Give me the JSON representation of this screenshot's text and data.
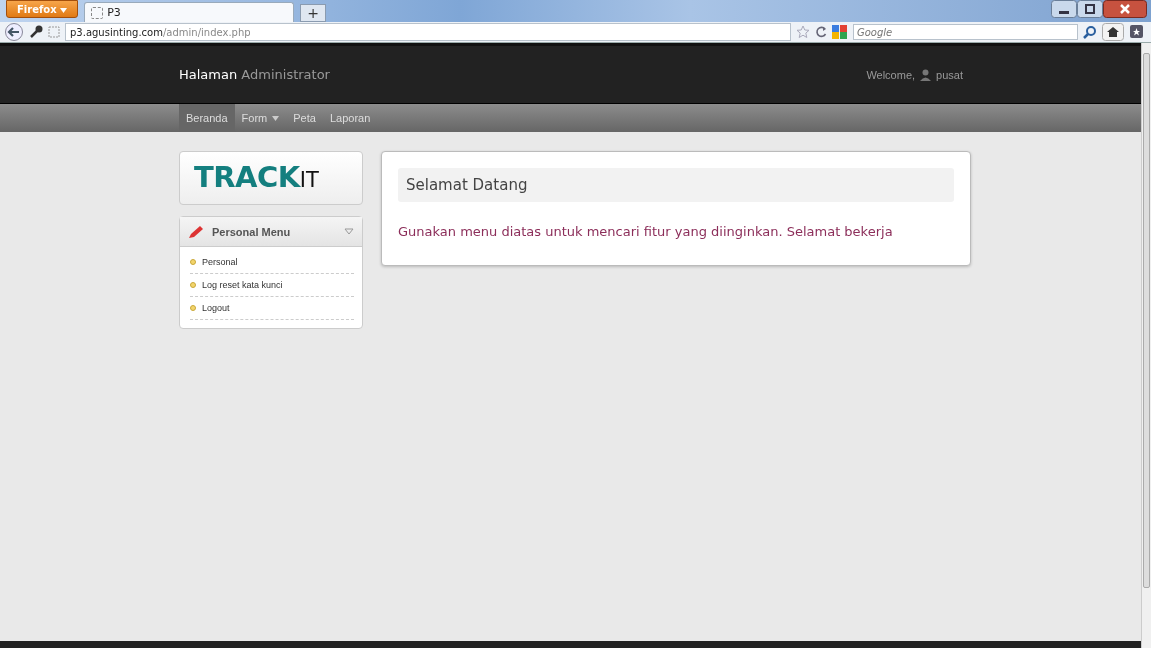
{
  "browser": {
    "menu_button": "Firefox",
    "tabs": [
      {
        "label": "P3",
        "selected": true
      }
    ],
    "new_tab": "+",
    "url_host": "p3.agusinting.com",
    "url_path": "/admin/index.php",
    "search": {
      "placeholder": "Google"
    }
  },
  "header": {
    "brand_bold": "Halaman",
    "brand_light": "Administrator",
    "welcome": "Welcome,",
    "user": "pusat"
  },
  "nav": [
    {
      "label": "Beranda",
      "selected": true,
      "dropdown": false
    },
    {
      "label": "Form",
      "selected": false,
      "dropdown": true
    },
    {
      "label": "Peta",
      "selected": false,
      "dropdown": false
    },
    {
      "label": "Laporan",
      "selected": false,
      "dropdown": false
    }
  ],
  "logo": {
    "main": "TRACK",
    "suffix": "IT"
  },
  "personal_menu": {
    "title": "Personal Menu",
    "items": [
      "Personal",
      "Log reset kata kunci",
      "Logout"
    ]
  },
  "main": {
    "title": "Selamat Datang",
    "message": "Gunakan menu diatas untuk mencari fitur yang diinginkan. Selamat bekerja"
  }
}
